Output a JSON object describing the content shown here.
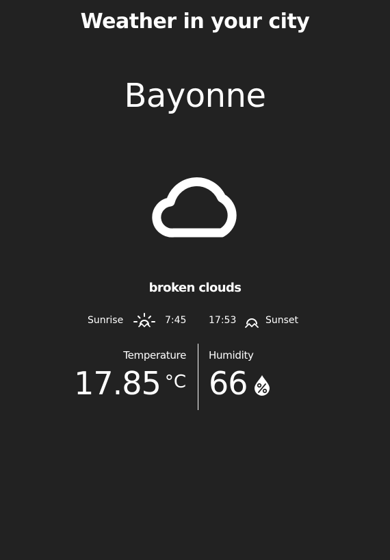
{
  "header": {
    "title": "Weather in your city"
  },
  "location": {
    "city": "Bayonne"
  },
  "current": {
    "icon": "cloud-icon",
    "description": "broken clouds"
  },
  "sun": {
    "sunrise_label": "Sunrise",
    "sunrise_icon": "sunrise-icon",
    "sunrise_time": "7:45",
    "sunset_time": "17:53",
    "sunset_icon": "sunset-icon",
    "sunset_label": "Sunset"
  },
  "stats": {
    "temperature_label": "Temperature",
    "temperature_value": "17.85",
    "temperature_unit": "°C",
    "humidity_label": "Humidity",
    "humidity_value": "66",
    "humidity_icon": "humidity-percent-icon"
  },
  "colors": {
    "background": "#222222",
    "text": "#ffffff"
  }
}
